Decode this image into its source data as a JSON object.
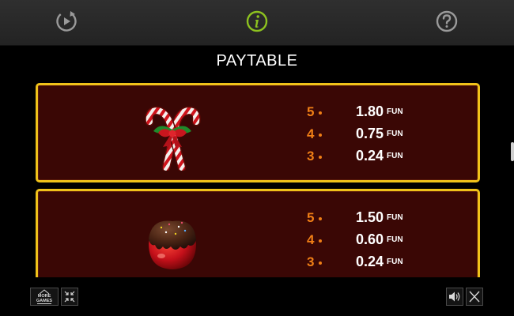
{
  "header": {
    "replay_icon": "replay-icon",
    "info_icon": "info-icon",
    "help_icon": "help-icon",
    "accent_color": "#8dc21f"
  },
  "paytable": {
    "title": "PAYTABLE",
    "currency": "FUN",
    "symbols": [
      {
        "name": "candy-cane",
        "pays": [
          {
            "count": "5",
            "value": "1.80"
          },
          {
            "count": "4",
            "value": "0.75"
          },
          {
            "count": "3",
            "value": "0.24"
          }
        ]
      },
      {
        "name": "chocolate-apple",
        "pays": [
          {
            "count": "5",
            "value": "1.50"
          },
          {
            "count": "4",
            "value": "0.60"
          },
          {
            "count": "3",
            "value": "0.24"
          }
        ]
      }
    ]
  },
  "footer": {
    "more_games_line1": "MORE",
    "more_games_line2": "GAMES",
    "shrink_icon": "shrink-icon",
    "sound_icon": "sound-icon",
    "close_icon": "close-icon"
  },
  "colors": {
    "card_bg": "#3a0705",
    "card_border": "#f0c21a",
    "count_color": "#f07f16"
  }
}
